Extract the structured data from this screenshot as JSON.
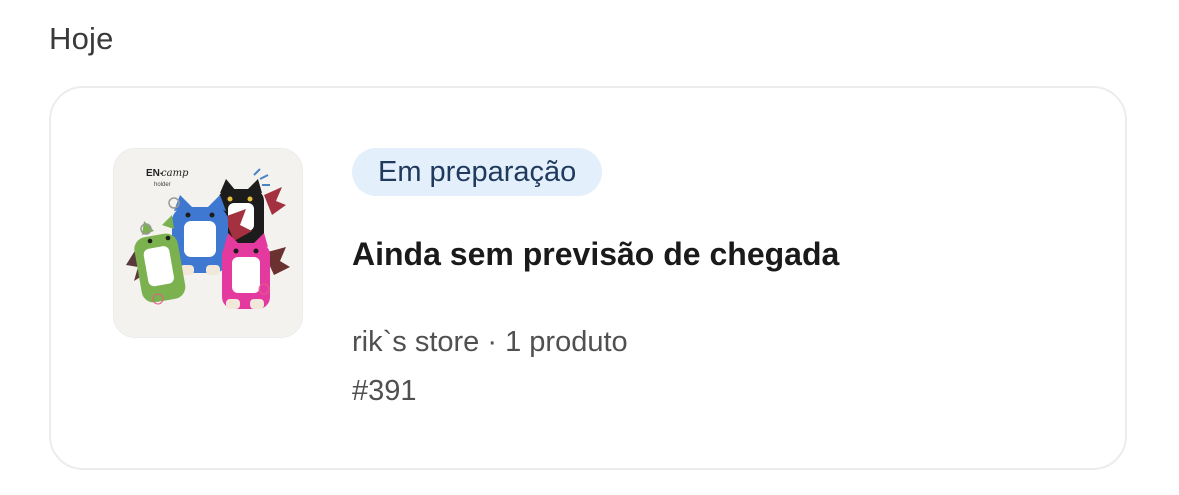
{
  "section": {
    "title": "Hoje"
  },
  "order": {
    "status": "Em preparação",
    "headline": "Ainda sem previsão de chegada",
    "store": "rik`s store",
    "separator": "·",
    "items": "1 produto",
    "number": "#391",
    "image": {
      "brand_text": "EN-",
      "brand_script": "camp",
      "brand_sub": "holder"
    }
  },
  "colors": {
    "badge_bg": "#e3effb",
    "badge_text": "#1f3a5c"
  }
}
